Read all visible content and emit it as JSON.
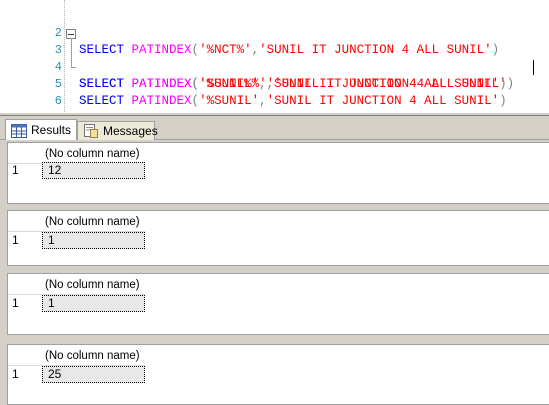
{
  "editor": {
    "lines": [
      {
        "num": "2",
        "keyword": "",
        "func": "",
        "str1": "",
        "str2": ""
      },
      {
        "num": "3",
        "keyword": "SELECT",
        "func": "PATINDEX",
        "str1": "'%NCT%'",
        "str2": "'SUNIL IT JUNCTION 4 ALL SUNIL'"
      },
      {
        "num": "4",
        "keyword": "SELECT",
        "func": "PATINDEX",
        "str1": "'%SUNIL%'",
        "str2": "'SUNIL IT JUNCTION 4 ALL SUNIL'"
      },
      {
        "num": "5",
        "keyword": "SELECT",
        "func": "PATINDEX",
        "str1": "'SUNIL%'",
        "str2": "'SUNIL IT JUNCTION 4 ALL SUNIL'"
      },
      {
        "num": "6",
        "keyword": "SELECT",
        "func": "PATINDEX",
        "str1": "'%SUNIL'",
        "str2": "'SUNIL IT JUNCTION 4 ALL SUNIL'"
      }
    ]
  },
  "tabs": [
    {
      "label": "Results",
      "icon": "grid-icon",
      "active": true
    },
    {
      "label": "Messages",
      "icon": "messages-icon",
      "active": false
    }
  ],
  "results": [
    {
      "column_header": "(No column name)",
      "row_number": "1",
      "value": "12"
    },
    {
      "column_header": "(No column name)",
      "row_number": "1",
      "value": "1"
    },
    {
      "column_header": "(No column name)",
      "row_number": "1",
      "value": "1"
    },
    {
      "column_header": "(No column name)",
      "row_number": "1",
      "value": "25"
    }
  ],
  "colors": {
    "keyword": "#0000ff",
    "function": "#ff00ff",
    "string": "#ff0000",
    "line_number": "#2b91af"
  }
}
